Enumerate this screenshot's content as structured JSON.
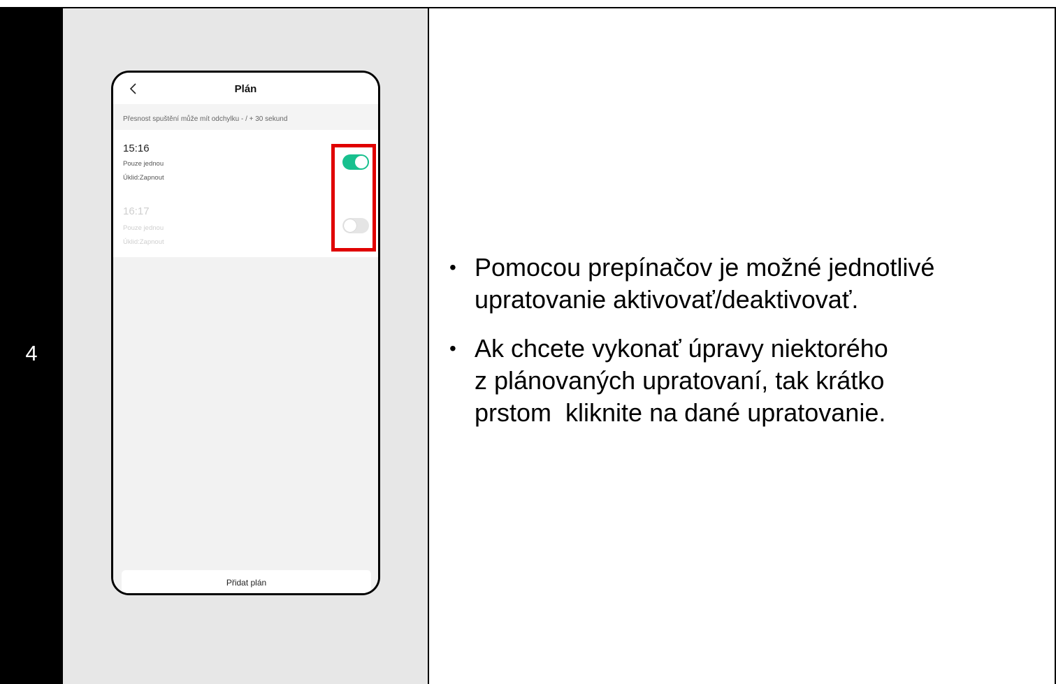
{
  "step": {
    "number": "4"
  },
  "phone": {
    "title": "Plán",
    "notice": "Přesnost spuštění může mít odchylku - / + 30 sekund",
    "plans": [
      {
        "time": "15:16",
        "repeat": "Pouze jednou",
        "action": "Úklid:Zapnout",
        "enabled": true
      },
      {
        "time": "16:17",
        "repeat": "Pouze jednou",
        "action": "Úklid:Zapnout",
        "enabled": false
      }
    ],
    "add_button": "Přidat plán",
    "icons": {
      "back": "chevron-left-icon"
    },
    "colors": {
      "toggle_on": "#18c08e",
      "toggle_off": "#e5e5e5",
      "highlight": "#e00000"
    }
  },
  "instructions": {
    "bullet_symbol": "•",
    "items": [
      {
        "lines": [
          "Pomocou prepínačov je možné jednotlivé",
          "upratovanie aktivovať/deaktivovať."
        ]
      },
      {
        "lines": [
          "Ak chcete vykonať úpravy niektorého",
          "z plánovaných upratovaní, tak krátko",
          "prstom  kliknite na dané upratovanie."
        ]
      }
    ]
  }
}
